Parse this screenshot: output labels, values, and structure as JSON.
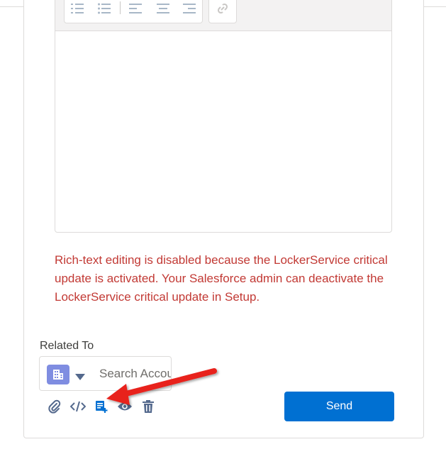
{
  "editor": {
    "toolbar": {
      "groups": [
        "list-group",
        "align-group",
        "link-group"
      ]
    }
  },
  "error_message": "Rich-text editing is disabled because the LockerService critical update is activated. Your Salesforce admin can deactivate the LockerService critical update in Setup.",
  "related_to": {
    "label": "Related To",
    "search_placeholder": "Search Accounts...",
    "object_icon": "account-icon"
  },
  "action_icons": [
    "paperclip-icon",
    "code-icon",
    "insert-template-icon",
    "eye-icon",
    "trash-icon"
  ],
  "send_label": "Send",
  "colors": {
    "primary": "#0070d2",
    "error": "#c23934",
    "account_icon_bg": "#7f8de1",
    "arrow": "#e8201a"
  }
}
